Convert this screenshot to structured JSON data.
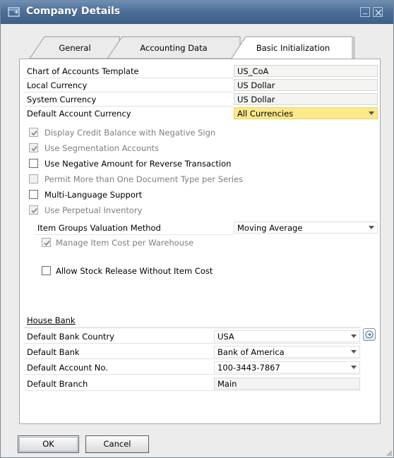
{
  "window": {
    "title": "Company Details",
    "minimize_label": "Minimize",
    "close_label": "Close"
  },
  "tabs": [
    {
      "label": "General",
      "active": false
    },
    {
      "label": "Accounting Data",
      "active": false
    },
    {
      "label": "Basic Initialization",
      "active": true
    }
  ],
  "fields": {
    "chart_of_accounts_template": {
      "label": "Chart of Accounts Template",
      "value": "US_CoA"
    },
    "local_currency": {
      "label": "Local Currency",
      "value": "US Dollar"
    },
    "system_currency": {
      "label": "System Currency",
      "value": "US Dollar"
    },
    "default_account_currency": {
      "label": "Default Account Currency",
      "value": "All Currencies"
    }
  },
  "options": [
    {
      "label": "Display Credit Balance with Negative Sign",
      "checked": true,
      "enabled": false
    },
    {
      "label": "Use Segmentation Accounts",
      "checked": true,
      "enabled": false
    },
    {
      "label": "Use Negative Amount for Reverse Transaction",
      "checked": false,
      "enabled": true
    },
    {
      "label": "Permit More than One Document Type per Series",
      "checked": false,
      "enabled": false
    },
    {
      "label": "Multi-Language Support",
      "checked": false,
      "enabled": true
    },
    {
      "label": "Use Perpetual Inventory",
      "checked": true,
      "enabled": false
    }
  ],
  "inventory": {
    "valuation_method_label": "Item Groups Valuation Method",
    "valuation_method_value": "Moving Average",
    "manage_cost_label": "Manage Item Cost per Warehouse",
    "manage_cost_checked": true,
    "allow_stock_release_label": "Allow Stock Release Without Item Cost",
    "allow_stock_release_checked": false
  },
  "house_bank": {
    "section_label": "House Bank",
    "country_label": "Default Bank Country",
    "country_value": "USA",
    "bank_label": "Default Bank",
    "bank_value": "Bank of America",
    "account_label": "Default Account No.",
    "account_value": "100-3443-7867",
    "branch_label": "Default Branch",
    "branch_value": "Main"
  },
  "buttons": {
    "ok": "OK",
    "cancel": "Cancel"
  },
  "colors": {
    "title_bar": "#4d6f98",
    "highlight_field": "#fbe98a"
  },
  "icons": {
    "title": "form-icon",
    "link": "link-arrow-icon"
  }
}
